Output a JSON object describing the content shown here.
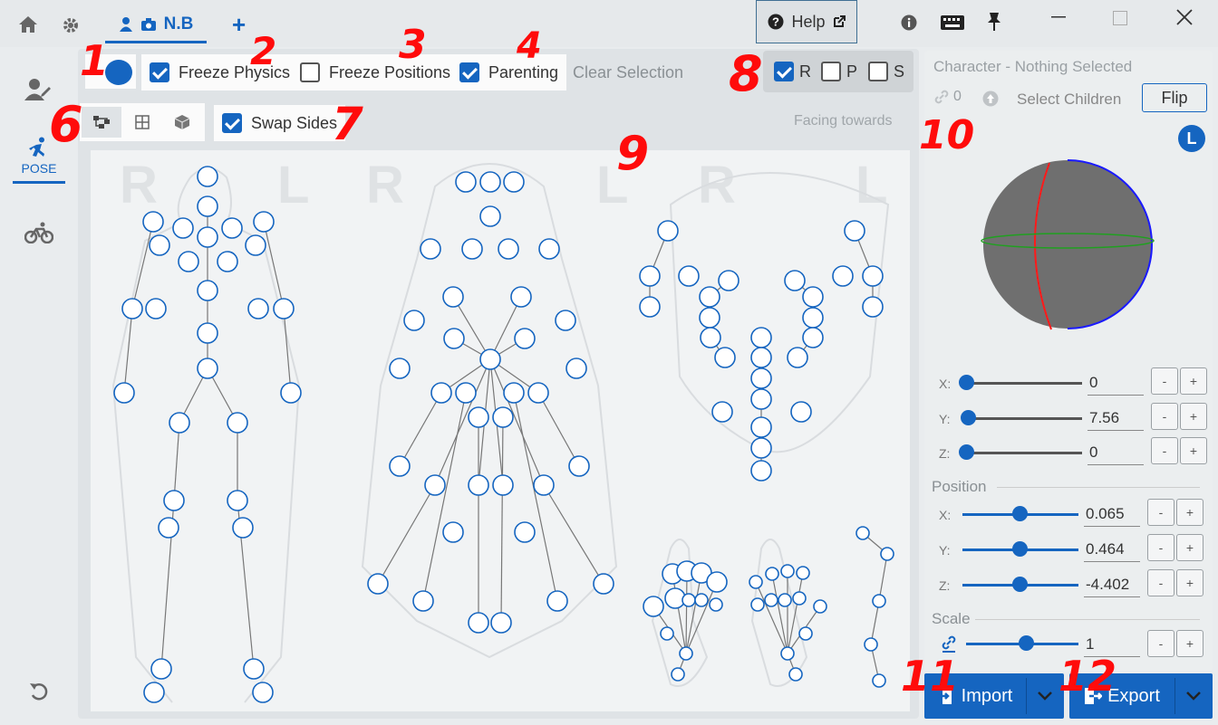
{
  "titlebar": {
    "character_tab_label": "N.B",
    "add_tab_label": "+",
    "help_label": "Help"
  },
  "leftbar": {
    "pose_label": "POSE"
  },
  "toolbar": {
    "freeze_physics_label": "Freeze Physics",
    "freeze_physics_checked": true,
    "freeze_positions_label": "Freeze Positions",
    "freeze_positions_checked": false,
    "parenting_label": "Parenting",
    "parenting_checked": true,
    "clear_selection_label": "Clear Selection",
    "rps": [
      {
        "label": "R",
        "checked": true
      },
      {
        "label": "P",
        "checked": false
      },
      {
        "label": "S",
        "checked": false
      }
    ],
    "swap_sides_label": "Swap Sides",
    "swap_sides_checked": true,
    "facing_label": "Facing towards"
  },
  "canvas": {
    "side_letters": [
      "R",
      "L",
      "R",
      "L",
      "R",
      "L"
    ]
  },
  "right_panel": {
    "title": "Character - Nothing Selected",
    "link_count": "0",
    "select_children_label": "Select Children",
    "flip_label": "Flip",
    "side_badge": "L",
    "rotation": [
      {
        "axis": "X:",
        "value": "0"
      },
      {
        "axis": "Y:",
        "value": "7.56"
      },
      {
        "axis": "Z:",
        "value": "0"
      }
    ],
    "position_label": "Position",
    "position": [
      {
        "axis": "X:",
        "value": "0.065"
      },
      {
        "axis": "Y:",
        "value": "0.464"
      },
      {
        "axis": "Z:",
        "value": "-4.402"
      }
    ],
    "scale_label": "Scale",
    "scale_value": "1",
    "minus_label": "-",
    "plus_label": "+"
  },
  "footer": {
    "import_label": "Import",
    "export_label": "Export"
  },
  "annotations": [
    "1",
    "2",
    "3",
    "4",
    "6",
    "7",
    "8",
    "9",
    "10",
    "11",
    "12"
  ]
}
